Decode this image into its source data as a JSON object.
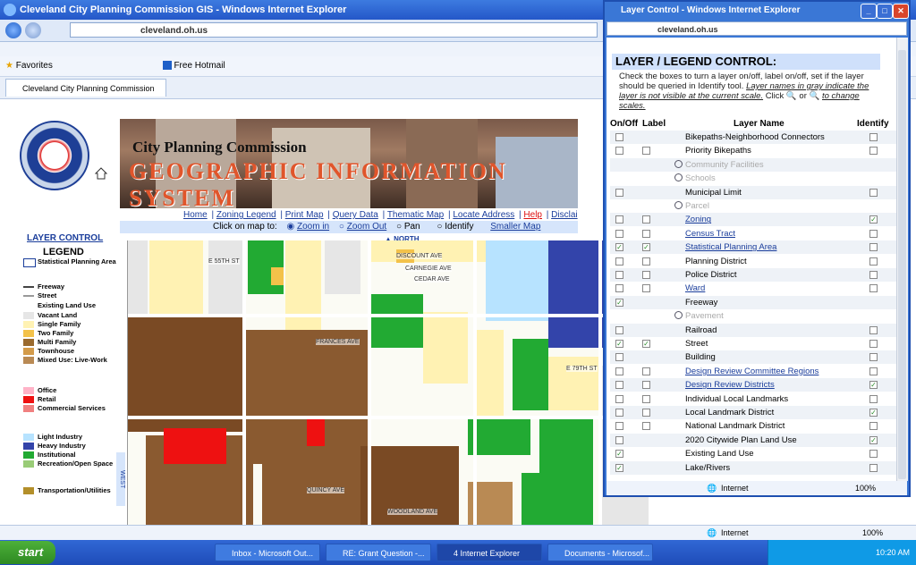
{
  "main_window": {
    "title": "Cleveland City Planning Commission GIS - Windows Internet Explorer",
    "url_host": "cleveland.oh.us",
    "favorites_label": "Favorites",
    "fav_item": "Free Hotmail",
    "tab_label": "Cleveland City Planning Commission GIS",
    "status": "Internet",
    "zoom": "100%"
  },
  "page": {
    "banner_title": "City Planning Commission",
    "banner_gis": "GEOGRAPHIC INFORMATION SYSTEM",
    "links": [
      "Home",
      "Zoning Legend",
      "Print Map",
      "Query Data",
      "Thematic Map",
      "Locate Address",
      "Help",
      "Disclai"
    ],
    "toolbar": {
      "click_on_map": "Click on map to:",
      "zoom_in": "Zoom in",
      "zoom_out": "Zoom Out",
      "pan": "Pan",
      "identify": "Identify",
      "smaller_map": "Smaller Map"
    },
    "north": "NORTH",
    "west": "WEST",
    "layer_control_link": "LAYER CONTROL"
  },
  "legend": {
    "title": "LEGEND",
    "items": [
      {
        "label": "Statistical Planning Area",
        "color": "#ffffff"
      },
      {
        "label": "Freeway",
        "color": "#444444"
      },
      {
        "label": "Street",
        "color": "#999999"
      },
      {
        "label": "Existing Land Use",
        "color": ""
      },
      {
        "label": "Vacant Land",
        "color": "#e6e6e6"
      },
      {
        "label": "Single Family",
        "color": "#fff2b3"
      },
      {
        "label": "Two Family",
        "color": "#f3c24a"
      },
      {
        "label": "Multi Family",
        "color": "#9a6a2e"
      },
      {
        "label": "Townhouse",
        "color": "#d39b4a"
      },
      {
        "label": "Mixed Use: Live-Work",
        "color": "#b98a54"
      },
      {
        "label": "Office",
        "color": "#ffb3c7"
      },
      {
        "label": "Retail",
        "color": "#ee1111"
      },
      {
        "label": "Commercial Services",
        "color": "#f08080"
      },
      {
        "label": "Light Industry",
        "color": "#b7e3ff"
      },
      {
        "label": "Heavy Industry",
        "color": "#3344aa"
      },
      {
        "label": "Institutional",
        "color": "#22aa33"
      },
      {
        "label": "Recreation/Open Space",
        "color": "#99cc77"
      },
      {
        "label": "Transportation/Utilities",
        "color": "#b38f2a"
      }
    ]
  },
  "map_labels": [
    "DISCOUNT AVE",
    "CARNEGIE AVE",
    "CEDAR AVE",
    "FRANCES AVE",
    "E 79TH ST",
    "E 55TH ST",
    "QUINCY AVE",
    "WOODLAND AVE"
  ],
  "popup": {
    "title": "Layer Control - Windows Internet Explorer",
    "url_host": "cleveland.oh.us",
    "heading": "LAYER / LEGEND CONTROL:",
    "desc1": "Check the boxes to turn a layer on/off, label on/off, set if the layer should be queried in Identify tool.",
    "desc2": "Layer names in gray indicate the layer is not visible at the current scale.",
    "desc3": "Click",
    "desc4": "or",
    "desc5": "to change scales.",
    "headers": {
      "onoff": "On/Off",
      "label": "Label",
      "name": "Layer Name",
      "identify": "Identify"
    },
    "rows": [
      {
        "name": "Bikepaths-Neighborhood Connectors",
        "on": false,
        "label": null,
        "id": false,
        "style": "plain"
      },
      {
        "name": "Priority Bikepaths",
        "on": false,
        "label": false,
        "id": false,
        "style": "plain"
      },
      {
        "name": "Community Facilities",
        "on": null,
        "label": null,
        "id": null,
        "style": "grey",
        "mag": true
      },
      {
        "name": "Schools",
        "on": null,
        "label": null,
        "id": null,
        "style": "grey",
        "mag": true
      },
      {
        "name": "Municipal Limit",
        "on": false,
        "label": null,
        "id": false,
        "style": "plain"
      },
      {
        "name": "Parcel",
        "on": null,
        "label": null,
        "id": null,
        "style": "grey",
        "mag": true
      },
      {
        "name": "Zoning",
        "on": false,
        "label": false,
        "id": true,
        "style": "link"
      },
      {
        "name": "Census Tract",
        "on": false,
        "label": false,
        "id": false,
        "style": "link"
      },
      {
        "name": "Statistical Planning Area",
        "on": true,
        "label": true,
        "id": false,
        "style": "link"
      },
      {
        "name": "Planning District",
        "on": false,
        "label": false,
        "id": false,
        "style": "plain"
      },
      {
        "name": "Police District",
        "on": false,
        "label": false,
        "id": false,
        "style": "plain"
      },
      {
        "name": "Ward",
        "on": false,
        "label": false,
        "id": false,
        "style": "link"
      },
      {
        "name": "Freeway",
        "on": true,
        "label": null,
        "id": null,
        "style": "plain"
      },
      {
        "name": "Pavement",
        "on": null,
        "label": null,
        "id": null,
        "style": "grey",
        "mag": true
      },
      {
        "name": "Railroad",
        "on": false,
        "label": null,
        "id": false,
        "style": "plain"
      },
      {
        "name": "Street",
        "on": true,
        "label": true,
        "id": false,
        "style": "plain"
      },
      {
        "name": "Building",
        "on": false,
        "label": null,
        "id": false,
        "style": "plain"
      },
      {
        "name": "Design Review Committee Regions",
        "on": false,
        "label": false,
        "id": false,
        "style": "link"
      },
      {
        "name": "Design Review Districts",
        "on": false,
        "label": false,
        "id": true,
        "style": "link"
      },
      {
        "name": "Individual Local Landmarks",
        "on": false,
        "label": false,
        "id": false,
        "style": "plain"
      },
      {
        "name": "Local Landmark District",
        "on": false,
        "label": false,
        "id": true,
        "style": "plain"
      },
      {
        "name": "National Landmark District",
        "on": false,
        "label": false,
        "id": false,
        "style": "plain"
      },
      {
        "name": "2020 Citywide Plan Land Use",
        "on": false,
        "label": null,
        "id": true,
        "style": "plain"
      },
      {
        "name": "Existing Land Use",
        "on": true,
        "label": null,
        "id": false,
        "style": "plain"
      },
      {
        "name": "Lake/Rivers",
        "on": true,
        "label": null,
        "id": false,
        "style": "plain"
      }
    ],
    "status": "Internet",
    "zoom": "100%"
  },
  "taskbar": {
    "start": "start",
    "buttons": [
      "Inbox - Microsoft Out...",
      "RE: Grant Question -...",
      "4 Internet Explorer",
      "Documents - Microsof..."
    ],
    "clock": "10:20 AM"
  }
}
